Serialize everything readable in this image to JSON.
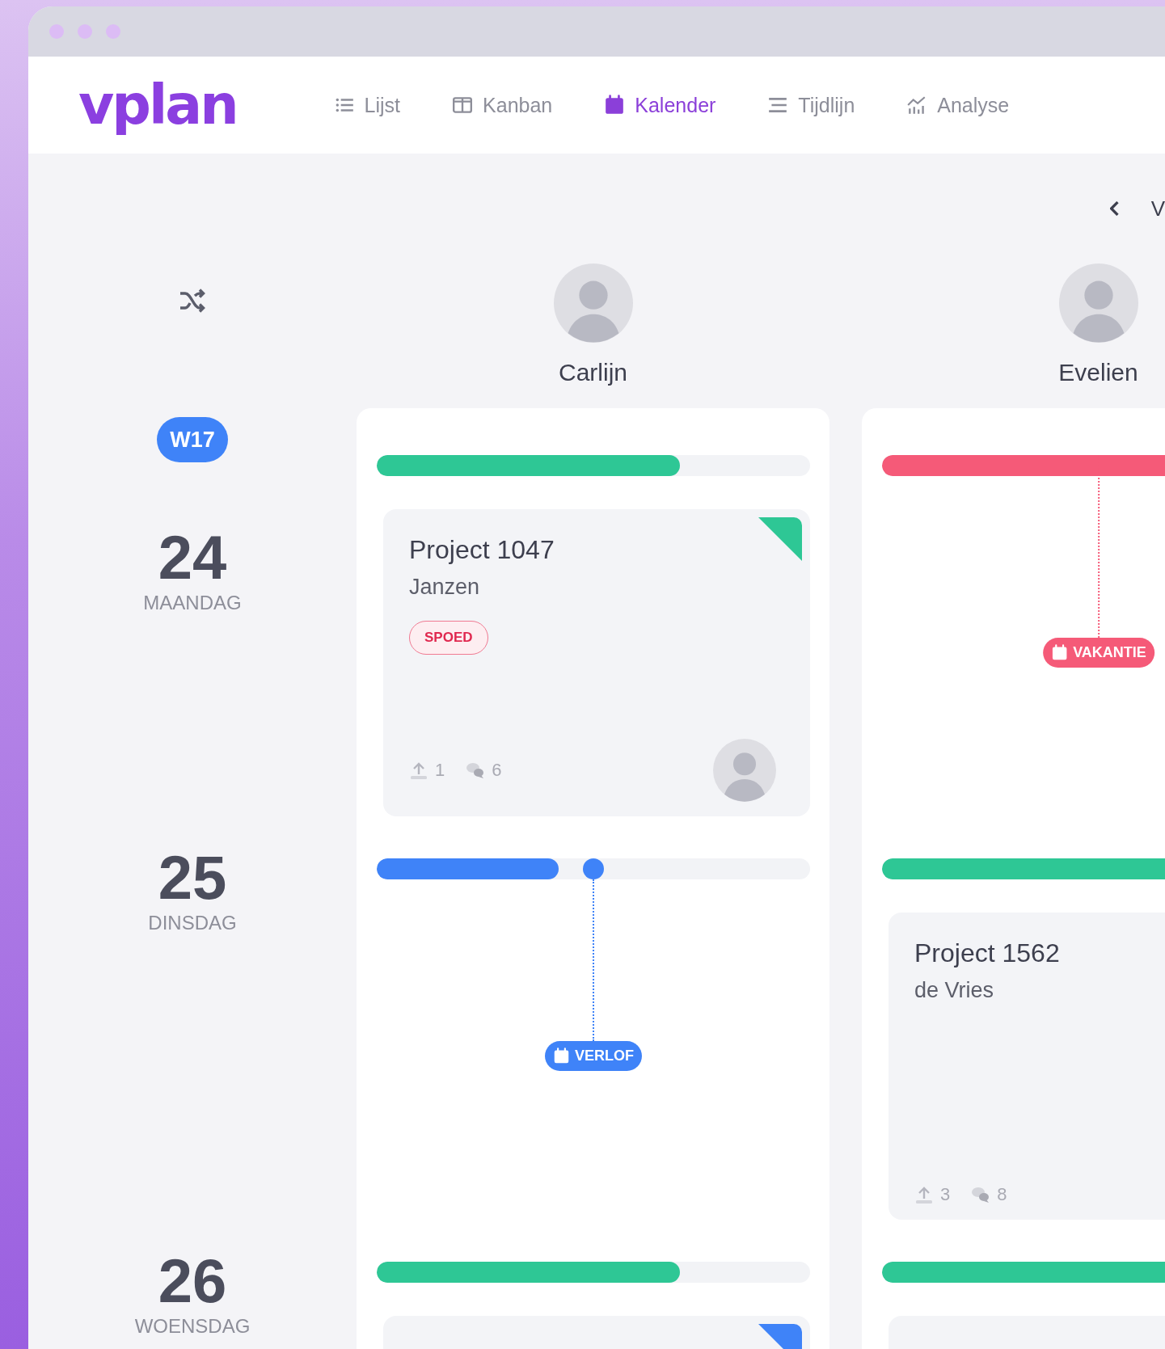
{
  "logo": "vplan",
  "nav": [
    {
      "label": "Lijst",
      "kind": "list",
      "selected": false
    },
    {
      "label": "Kanban",
      "kind": "board",
      "selected": false
    },
    {
      "label": "Kalender",
      "kind": "calendar",
      "selected": true
    },
    {
      "label": "Tijdlijn",
      "kind": "timeline",
      "selected": false
    },
    {
      "label": "Analyse",
      "kind": "chart",
      "selected": false
    }
  ],
  "pager": {
    "next_label": "V"
  },
  "week": "W17",
  "people": [
    {
      "name": "Carlijn"
    },
    {
      "name": "Evelien"
    }
  ],
  "days": [
    {
      "number": "24",
      "weekday": "MAANDAG",
      "cells": [
        {
          "kind": "project",
          "capacity": {
            "level": 0.7,
            "color": "#2ec795"
          },
          "card": {
            "title": "Project 1047",
            "client": "Janzen",
            "tag": "SPOED",
            "uploads": "1",
            "comments": "6",
            "assignee_avatar": true,
            "color": "#2ec795"
          }
        },
        {
          "kind": "absence",
          "capacity": {
            "level": 1,
            "color": "#f55a78"
          },
          "absence": {
            "label": "VAKANTIE",
            "color": "#f55a78",
            "marker_dot": false
          }
        }
      ]
    },
    {
      "number": "25",
      "weekday": "DINSDAG",
      "cells": [
        {
          "kind": "absence",
          "capacity": {
            "level": 0.42,
            "color": "#3f83f8"
          },
          "absence": {
            "label": "VERLOF",
            "color": "#3f83f8",
            "marker_dot": true
          }
        },
        {
          "kind": "project",
          "capacity": {
            "level": 1,
            "color": "#2ec795"
          },
          "card": {
            "title": "Project 1562",
            "client": "de Vries",
            "uploads": "3",
            "comments": "8"
          }
        }
      ]
    },
    {
      "number": "26",
      "weekday": "WOENSDAG",
      "cells": [
        {
          "kind": "project",
          "capacity": {
            "level": 0.7,
            "color": "#2ec795"
          },
          "card": {
            "color": "#3f83f8"
          }
        },
        {
          "kind": "project",
          "capacity": {
            "level": 1,
            "color": "#2ec795"
          }
        }
      ]
    }
  ]
}
